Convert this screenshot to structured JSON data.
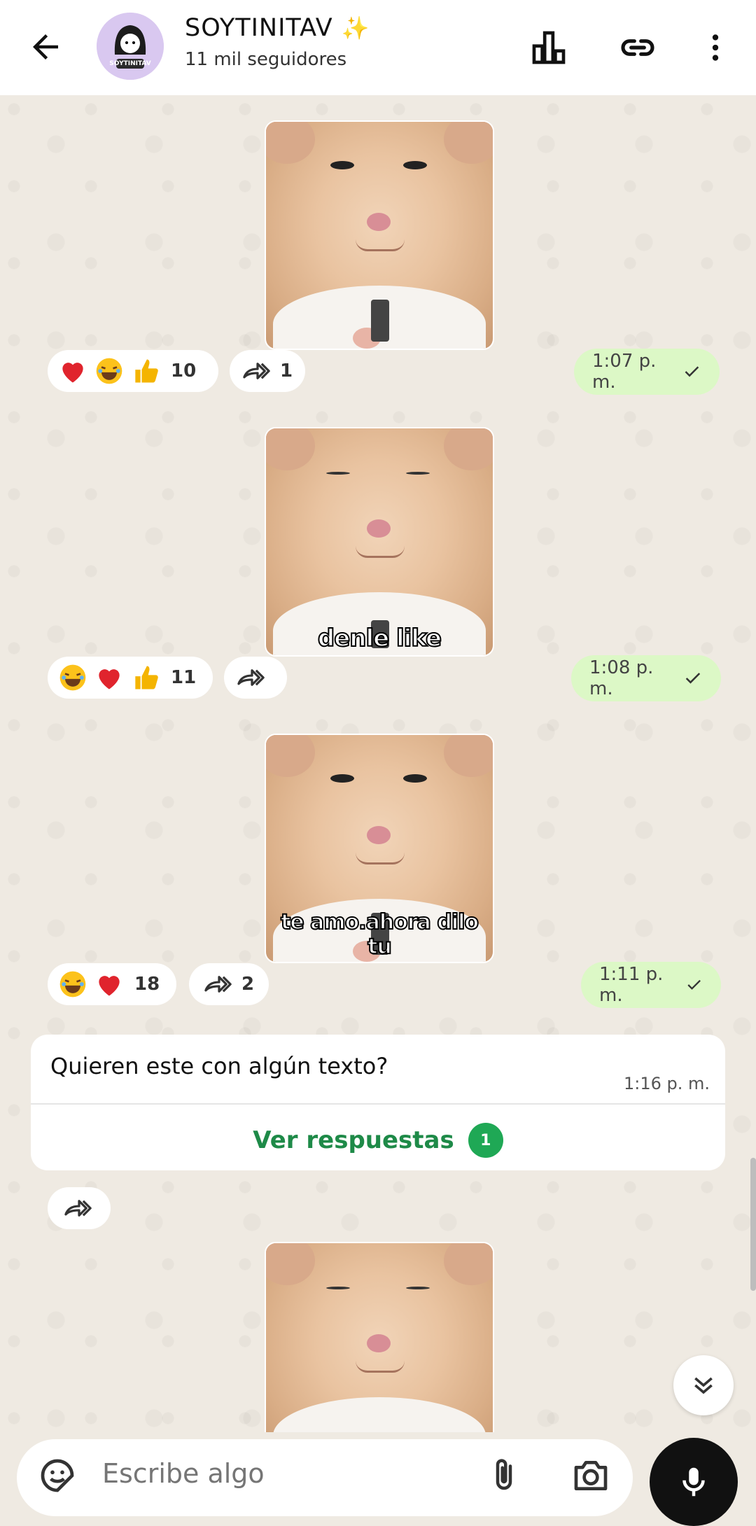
{
  "header": {
    "channel_name": "SOYTINITAV",
    "sparkle": "✨",
    "followers": "11 mil seguidores",
    "avatar_label": "SOYTINITAV"
  },
  "posts": [
    {
      "caption": "",
      "reactions": [
        "heart",
        "laugh",
        "thumbs-up"
      ],
      "reaction_count": "10",
      "forwards": "1",
      "time": "1:07 p. m."
    },
    {
      "caption": "denle like",
      "reactions": [
        "laugh",
        "heart",
        "thumbs-up"
      ],
      "reaction_count": "11",
      "forwards": "",
      "time": "1:08 p. m."
    },
    {
      "caption": "te amo.ahora dilo tu",
      "reactions": [
        "laugh",
        "heart"
      ],
      "reaction_count": "18",
      "forwards": "2",
      "time": "1:11 p. m."
    }
  ],
  "text_post": {
    "message": "Quieren este con algún texto?",
    "time": "1:16 p. m.",
    "replies_label": "Ver respuestas",
    "replies_count": "1"
  },
  "input": {
    "placeholder": "Escribe algo"
  },
  "icons": {
    "back": "arrow-left-icon",
    "insights": "bar-chart-icon",
    "link": "link-icon",
    "menu": "more-vert-icon",
    "forward": "forward-icon",
    "scroll": "double-chevron-down-icon",
    "sticker": "sticker-icon",
    "attach": "paperclip-icon",
    "camera": "camera-icon",
    "mic": "mic-icon"
  },
  "colors": {
    "time_bubble": "#dcf8c6",
    "accent_green": "#1e8a48",
    "badge_green": "#1fa855",
    "chat_bg": "#efeae2"
  }
}
